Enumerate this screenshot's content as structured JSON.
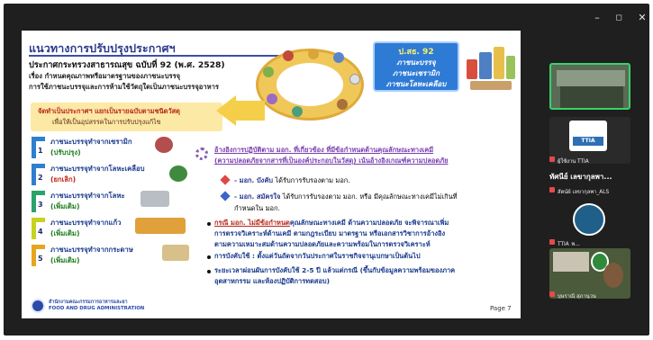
{
  "window": {
    "minimize_glyph": "–",
    "maximize_glyph": "◻",
    "close_glyph": "✕"
  },
  "slide": {
    "title": "แนวทางการปรับปรุงประกาศฯ",
    "subtitle1": "ประกาศกระทรวงสาธารณสุข ฉบับที่ 92 (พ.ศ. 2528)",
    "subtitle2": "เรื่อง กำหนดคุณภาพหรือมาตรฐานของภาชนะบรรจุ",
    "subtitle3": "การใช้ภาชนะบรรจุและการห้ามใช้วัตถุใดเป็นภาชนะบรรจุอาหาร",
    "yellow_box": {
      "line1": "จัดทำเป็นประกาศฯ แยกเป็นรายฉบับตามชนิดวัสดุ",
      "line2": "เพื่อให้เป็นอุปสรรคในการปรับปรุงแก้ไข"
    },
    "blue_box": {
      "line1": "ป.สธ. 92",
      "line2": "ภาชนะบรรจุ",
      "line3": "ภาชนะเซรามิก",
      "line4": "ภาชนะโลหะเคลือบ"
    },
    "items": [
      {
        "num": "1",
        "name": "ภาชนะบรรจุทำจากเซรามิก",
        "status": "(ปรับปรุง)",
        "status_color": "#1e7d1e",
        "color": "#2f7fd0"
      },
      {
        "num": "2",
        "name": "ภาชนะบรรจุทำจากโลหะเคลือบ",
        "status": "(ยกเลิก)",
        "status_color": "#c0251d",
        "color": "#2f7fd0"
      },
      {
        "num": "3",
        "name": "ภาชนะบรรจุทำจากโลหะ",
        "status": "(เพิ่มเติม)",
        "status_color": "#1e7d1e",
        "color": "#2aa36a"
      },
      {
        "num": "4",
        "name": "ภาชนะบรรจุทำจากแก้ว",
        "status": "(เพิ่มเติม)",
        "status_color": "#1e7d1e",
        "color": "#c8d21f"
      },
      {
        "num": "5",
        "name": "ภาชนะบรรจุทำจากกระดาษ",
        "status": "(เพิ่มเติม)",
        "status_color": "#1e7d1e",
        "color": "#e7a51f"
      }
    ],
    "right": {
      "line1": "อ้างอิงการปฏิบัติตาม มอก. ที่เกี่ยวข้อง ที่มีข้อกำหนดด้านคุณลักษณะทางเคมี",
      "line2": "(ความปลอดภัยจากสารที่เป็นองค์ประกอบในวัสดุ) เน้นอ้างอิงเกณฑ์ความปลอดภัย",
      "line3a": "- มอก. บังคับ",
      "line3b": " ได้รับการรับรองตาม มอก.",
      "line4a": "- มอก. สมัครใจ",
      "line4b": " ได้รับการรับรองตาม มอก. หรือ มีคุณลักษณะทางเคมีไม่เกินที่",
      "line5": "กำหนดใน มอก.",
      "line6a": "กรณี มอก. ไม่มีข้อกำหนด",
      "line6b": "คุณลักษณะทางเคมี ด้านความปลอดภัย จะพิจารณาเพิ่ม",
      "line7": "การตรวจวิเคราะห์ด้านเคมี ตามกฎระเบียบ มาตรฐาน หรือเอกสารวิชาการอ้างอิง",
      "line8": "ตามความเหมาะสมด้านความปลอดภัยและความพร้อมในการตรวจวิเคราะห์",
      "line9": "การบังคับใช้ : ตั้งแต่วันถัดจากวันประกาศในราชกิจจานุเบกษาเป็นต้นไป",
      "line10": "ระยะเวลาผ่อนผันการบังคับใช้ 2-5 ปี แล้วแต่กรณี (ขึ้นกับข้อมูลความพร้อมของภาค",
      "line11": "อุตสาหกรรม และห้องปฏิบัติการทดสอบ)"
    },
    "footer": {
      "line1": "สำนักงานคณะกรรมการอาหารและยา",
      "line2": "FOOD AND DRUG ADMINISTRATION"
    },
    "page": "Page 7"
  },
  "participants": [
    {
      "name": "",
      "tile_color": "#5a6b55"
    },
    {
      "name": "ผู้ใช้งาน TTIA",
      "logo": "TTIA",
      "tile_color": "#2a2a2a"
    },
    {
      "name": "ทัศนีย์ เลขากุลพา...",
      "tile_color": "#1f1f1f"
    },
    {
      "name": "สัตน์ผ์ เลขากุลพา_ALS",
      "tile_color": "#1f1f1f"
    },
    {
      "name": "TTIA_พ...",
      "tile_color": "#1f5f8a"
    },
    {
      "name": "บุษราณี สุภานุวน",
      "tile_color": "#4a5a3a"
    }
  ],
  "colors": {
    "meet_bg": "#1f1f1f",
    "slide_title": "#2a3a8c",
    "yellow": "#fde9a6",
    "blue_box": "#2e7bd6"
  }
}
